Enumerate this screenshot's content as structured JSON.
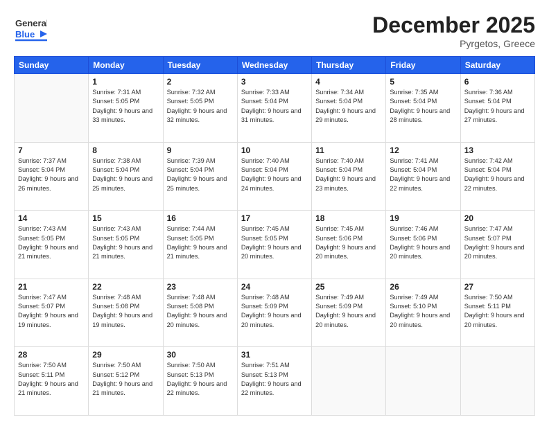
{
  "header": {
    "logo_general": "General",
    "logo_blue": "Blue",
    "month_year": "December 2025",
    "location": "Pyrgetos, Greece"
  },
  "weekdays": [
    "Sunday",
    "Monday",
    "Tuesday",
    "Wednesday",
    "Thursday",
    "Friday",
    "Saturday"
  ],
  "weeks": [
    [
      {
        "day": "",
        "sunrise": "",
        "sunset": "",
        "daylight": ""
      },
      {
        "day": "1",
        "sunrise": "Sunrise: 7:31 AM",
        "sunset": "Sunset: 5:05 PM",
        "daylight": "Daylight: 9 hours and 33 minutes."
      },
      {
        "day": "2",
        "sunrise": "Sunrise: 7:32 AM",
        "sunset": "Sunset: 5:05 PM",
        "daylight": "Daylight: 9 hours and 32 minutes."
      },
      {
        "day": "3",
        "sunrise": "Sunrise: 7:33 AM",
        "sunset": "Sunset: 5:04 PM",
        "daylight": "Daylight: 9 hours and 31 minutes."
      },
      {
        "day": "4",
        "sunrise": "Sunrise: 7:34 AM",
        "sunset": "Sunset: 5:04 PM",
        "daylight": "Daylight: 9 hours and 29 minutes."
      },
      {
        "day": "5",
        "sunrise": "Sunrise: 7:35 AM",
        "sunset": "Sunset: 5:04 PM",
        "daylight": "Daylight: 9 hours and 28 minutes."
      },
      {
        "day": "6",
        "sunrise": "Sunrise: 7:36 AM",
        "sunset": "Sunset: 5:04 PM",
        "daylight": "Daylight: 9 hours and 27 minutes."
      }
    ],
    [
      {
        "day": "7",
        "sunrise": "Sunrise: 7:37 AM",
        "sunset": "Sunset: 5:04 PM",
        "daylight": "Daylight: 9 hours and 26 minutes."
      },
      {
        "day": "8",
        "sunrise": "Sunrise: 7:38 AM",
        "sunset": "Sunset: 5:04 PM",
        "daylight": "Daylight: 9 hours and 25 minutes."
      },
      {
        "day": "9",
        "sunrise": "Sunrise: 7:39 AM",
        "sunset": "Sunset: 5:04 PM",
        "daylight": "Daylight: 9 hours and 25 minutes."
      },
      {
        "day": "10",
        "sunrise": "Sunrise: 7:40 AM",
        "sunset": "Sunset: 5:04 PM",
        "daylight": "Daylight: 9 hours and 24 minutes."
      },
      {
        "day": "11",
        "sunrise": "Sunrise: 7:40 AM",
        "sunset": "Sunset: 5:04 PM",
        "daylight": "Daylight: 9 hours and 23 minutes."
      },
      {
        "day": "12",
        "sunrise": "Sunrise: 7:41 AM",
        "sunset": "Sunset: 5:04 PM",
        "daylight": "Daylight: 9 hours and 22 minutes."
      },
      {
        "day": "13",
        "sunrise": "Sunrise: 7:42 AM",
        "sunset": "Sunset: 5:04 PM",
        "daylight": "Daylight: 9 hours and 22 minutes."
      }
    ],
    [
      {
        "day": "14",
        "sunrise": "Sunrise: 7:43 AM",
        "sunset": "Sunset: 5:05 PM",
        "daylight": "Daylight: 9 hours and 21 minutes."
      },
      {
        "day": "15",
        "sunrise": "Sunrise: 7:43 AM",
        "sunset": "Sunset: 5:05 PM",
        "daylight": "Daylight: 9 hours and 21 minutes."
      },
      {
        "day": "16",
        "sunrise": "Sunrise: 7:44 AM",
        "sunset": "Sunset: 5:05 PM",
        "daylight": "Daylight: 9 hours and 21 minutes."
      },
      {
        "day": "17",
        "sunrise": "Sunrise: 7:45 AM",
        "sunset": "Sunset: 5:05 PM",
        "daylight": "Daylight: 9 hours and 20 minutes."
      },
      {
        "day": "18",
        "sunrise": "Sunrise: 7:45 AM",
        "sunset": "Sunset: 5:06 PM",
        "daylight": "Daylight: 9 hours and 20 minutes."
      },
      {
        "day": "19",
        "sunrise": "Sunrise: 7:46 AM",
        "sunset": "Sunset: 5:06 PM",
        "daylight": "Daylight: 9 hours and 20 minutes."
      },
      {
        "day": "20",
        "sunrise": "Sunrise: 7:47 AM",
        "sunset": "Sunset: 5:07 PM",
        "daylight": "Daylight: 9 hours and 20 minutes."
      }
    ],
    [
      {
        "day": "21",
        "sunrise": "Sunrise: 7:47 AM",
        "sunset": "Sunset: 5:07 PM",
        "daylight": "Daylight: 9 hours and 19 minutes."
      },
      {
        "day": "22",
        "sunrise": "Sunrise: 7:48 AM",
        "sunset": "Sunset: 5:08 PM",
        "daylight": "Daylight: 9 hours and 19 minutes."
      },
      {
        "day": "23",
        "sunrise": "Sunrise: 7:48 AM",
        "sunset": "Sunset: 5:08 PM",
        "daylight": "Daylight: 9 hours and 20 minutes."
      },
      {
        "day": "24",
        "sunrise": "Sunrise: 7:48 AM",
        "sunset": "Sunset: 5:09 PM",
        "daylight": "Daylight: 9 hours and 20 minutes."
      },
      {
        "day": "25",
        "sunrise": "Sunrise: 7:49 AM",
        "sunset": "Sunset: 5:09 PM",
        "daylight": "Daylight: 9 hours and 20 minutes."
      },
      {
        "day": "26",
        "sunrise": "Sunrise: 7:49 AM",
        "sunset": "Sunset: 5:10 PM",
        "daylight": "Daylight: 9 hours and 20 minutes."
      },
      {
        "day": "27",
        "sunrise": "Sunrise: 7:50 AM",
        "sunset": "Sunset: 5:11 PM",
        "daylight": "Daylight: 9 hours and 20 minutes."
      }
    ],
    [
      {
        "day": "28",
        "sunrise": "Sunrise: 7:50 AM",
        "sunset": "Sunset: 5:11 PM",
        "daylight": "Daylight: 9 hours and 21 minutes."
      },
      {
        "day": "29",
        "sunrise": "Sunrise: 7:50 AM",
        "sunset": "Sunset: 5:12 PM",
        "daylight": "Daylight: 9 hours and 21 minutes."
      },
      {
        "day": "30",
        "sunrise": "Sunrise: 7:50 AM",
        "sunset": "Sunset: 5:13 PM",
        "daylight": "Daylight: 9 hours and 22 minutes."
      },
      {
        "day": "31",
        "sunrise": "Sunrise: 7:51 AM",
        "sunset": "Sunset: 5:13 PM",
        "daylight": "Daylight: 9 hours and 22 minutes."
      },
      {
        "day": "",
        "sunrise": "",
        "sunset": "",
        "daylight": ""
      },
      {
        "day": "",
        "sunrise": "",
        "sunset": "",
        "daylight": ""
      },
      {
        "day": "",
        "sunrise": "",
        "sunset": "",
        "daylight": ""
      }
    ]
  ]
}
